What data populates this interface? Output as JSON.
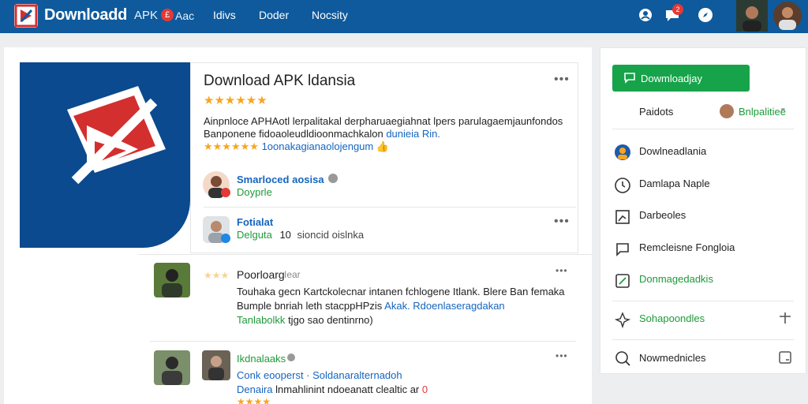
{
  "header": {
    "brand": "Downloadd",
    "brand_sub": "APK",
    "brand_badge": "£",
    "brand_sub2": "Aac",
    "nav": [
      {
        "label": "Idivs"
      },
      {
        "label": "Doder"
      },
      {
        "label": "Nocsity"
      }
    ],
    "notification_count": "2"
  },
  "app": {
    "title": "Download APK ldansia",
    "rating_stars": "★★★★★★",
    "more": "•••",
    "desc_line1": "Ainpnloce APHAotl lerpalitakal derpharuaegiahnat lpers parulagaemjaunfondos",
    "desc_line2": "Banponene fidoaoleudldioonmachkalon",
    "desc_line2_link": "dunieia Rin.",
    "meta_stars": "★★★★★★",
    "meta_text": "1oonakagianaolojengum",
    "meta_emoji": "👍"
  },
  "author": {
    "name": "Smarloced aosisa",
    "role": "Doyprle"
  },
  "info": {
    "name": "Fotialat",
    "label": "Delguta",
    "count": "10",
    "count_text": "sioncid oislnka",
    "more": "•••"
  },
  "comments": [
    {
      "name": "Poorloarg",
      "meta": "Iear",
      "more": "•••",
      "line1": "Touhaka gecn Kartckolecnar intanen fchlogene Itlank. Blere Ban femaka",
      "line2": "Bumple bnriah leth stacppHPzis",
      "line2_link": "Akak. Rdoenlaseragdakan",
      "line3_link": "Tanlabolkk",
      "line3": "tjgo sao dentinrno)"
    },
    {
      "name": "Ikdnalaaks",
      "more": "•••",
      "line1_a": "Conk eooperst",
      "line1_b": "Soldanaralternadoh",
      "line2_a": "Denaira",
      "line2_b": "lnmahlinint ndoeanatt clealtic ar",
      "stars": "★★★★"
    }
  ],
  "sidebar": {
    "download_label": "Dowmloadjay",
    "pair_left": "Paidots",
    "pair_right": "Bnlpalitiee",
    "pair_right_mark": "\"",
    "items": [
      {
        "label": "Dowlneadlania",
        "icon": "user-avatar-icon"
      },
      {
        "label": "Damlapa Naple",
        "icon": "clock-icon"
      },
      {
        "label": "Darbeoles",
        "icon": "chart-icon"
      },
      {
        "label": "Remcleisne Fongloia",
        "icon": "message-icon"
      },
      {
        "label": "Donmagedadkis",
        "icon": "edit-icon"
      },
      {
        "label": "Sohapoondles",
        "icon": "pin-icon"
      },
      {
        "label": "Nowmednicles",
        "icon": "search-icon"
      }
    ]
  },
  "colors": {
    "topbar": "#0e5a9c",
    "accent_green": "#17a34a",
    "link_blue": "#1565c0",
    "link_green": "#1e9a3a",
    "star": "#f5a623"
  }
}
